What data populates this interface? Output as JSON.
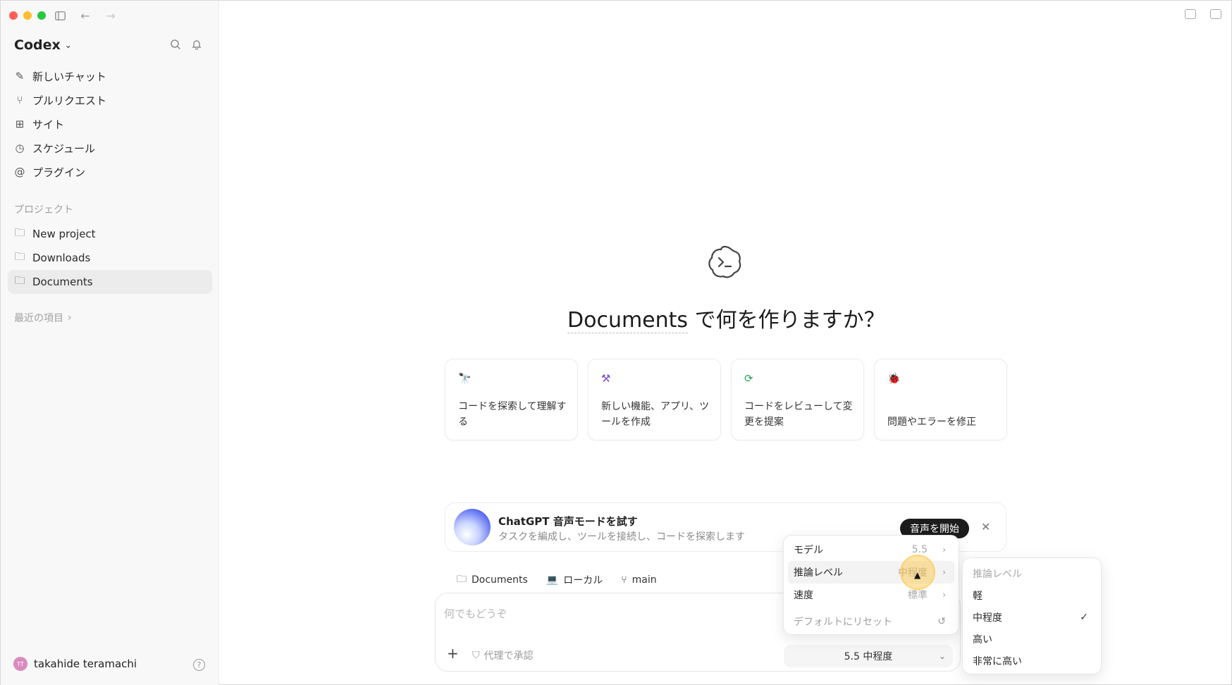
{
  "sidebar": {
    "brand": "Codex",
    "nav": [
      {
        "label": "新しいチャット",
        "icon": "edit-icon"
      },
      {
        "label": "プルリクエスト",
        "icon": "pull-request-icon"
      },
      {
        "label": "サイト",
        "icon": "grid-icon"
      },
      {
        "label": "スケジュール",
        "icon": "clock-icon"
      },
      {
        "label": "プラグイン",
        "icon": "at-icon"
      }
    ],
    "projects_label": "プロジェクト",
    "projects": [
      {
        "label": "New project"
      },
      {
        "label": "Downloads"
      },
      {
        "label": "Documents"
      }
    ],
    "recent_label": "最近の項目",
    "user": {
      "initials": "TT",
      "name": "takahide teramachi"
    }
  },
  "main": {
    "hero_project": "Documents",
    "hero_rest": " で何を作りますか？",
    "cards": [
      {
        "icon": "telescope-icon",
        "text": "コードを探索して理解する"
      },
      {
        "icon": "hammer-icon",
        "text": "新しい機能、アプリ、ツールを作成"
      },
      {
        "icon": "refresh-review-icon",
        "text": "コードをレビューして変更を提案"
      },
      {
        "icon": "bug-icon",
        "text": "問題やエラーを修正"
      }
    ],
    "voice": {
      "title": "ChatGPT 音声モードを試す",
      "subtitle": "タスクを編成し、ツールを接続し、コードを探索します",
      "button": "音声を開始"
    },
    "context": {
      "folder": "Documents",
      "env": "ローカル",
      "branch": "main"
    },
    "composer": {
      "placeholder": "何でもどうぞ",
      "approve": "代理で承認",
      "model_selector": "5.5 中程度"
    }
  },
  "menu": {
    "rows": [
      {
        "label": "モデル",
        "value": "5.5"
      },
      {
        "label": "推論レベル",
        "value": "中程度"
      },
      {
        "label": "速度",
        "value": "標準"
      }
    ],
    "reset": "デフォルトにリセット"
  },
  "submenu": {
    "header": "推論レベル",
    "options": [
      "軽",
      "中程度",
      "高い",
      "非常に高い"
    ],
    "selected": "中程度"
  }
}
